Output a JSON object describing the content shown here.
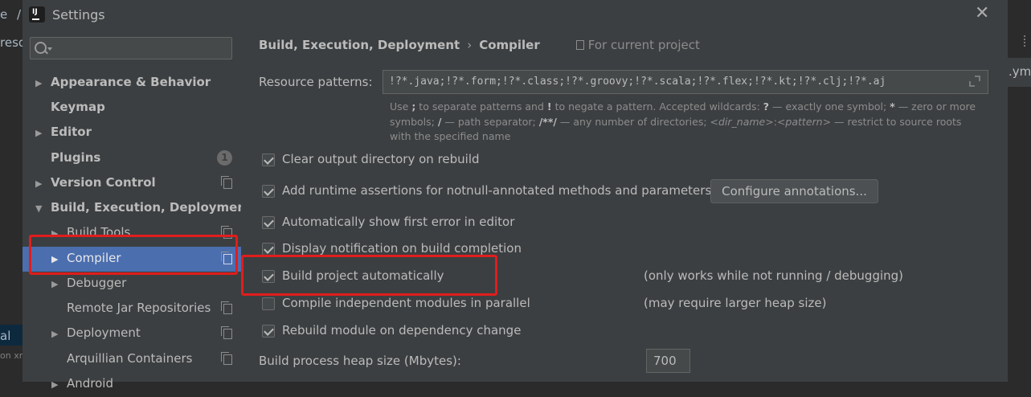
{
  "background": {
    "left_fragments": [
      "e",
      "/",
      "reso",
      "al",
      "on xm"
    ],
    "right_tab": ".yml"
  },
  "window": {
    "title": "Settings",
    "app_icon": "intellij-idea-icon",
    "close_glyph": "✕"
  },
  "sidebar": {
    "search": {
      "value": "",
      "placeholder": ""
    },
    "items": [
      {
        "label": "Appearance & Behavior",
        "arrow": "▶",
        "bold": true
      },
      {
        "label": "Keymap",
        "arrow": "",
        "bold": true
      },
      {
        "label": "Editor",
        "arrow": "▶",
        "bold": true
      },
      {
        "label": "Plugins",
        "arrow": "",
        "bold": true,
        "badge": "1"
      },
      {
        "label": "Version Control",
        "arrow": "▶",
        "bold": true,
        "project_icon": true
      },
      {
        "label": "Build, Execution, Deployment",
        "arrow": "▼",
        "bold": true
      },
      {
        "label": "Build Tools",
        "arrow": "▶",
        "project_icon": true
      },
      {
        "label": "Compiler",
        "arrow": "▶",
        "project_icon": true,
        "selected": true
      },
      {
        "label": "Debugger",
        "arrow": "▶"
      },
      {
        "label": "Remote Jar Repositories",
        "arrow": "",
        "project_icon": true
      },
      {
        "label": "Deployment",
        "arrow": "▶",
        "project_icon": true
      },
      {
        "label": "Arquillian Containers",
        "arrow": "",
        "project_icon": true
      },
      {
        "label": "Android",
        "arrow": "▶"
      }
    ]
  },
  "breadcrumb": {
    "parent": "Build, Execution, Deployment",
    "separator": "›",
    "current": "Compiler",
    "scope": "For current project"
  },
  "resource_patterns": {
    "label": "Resource patterns:",
    "value": "!?*.java;!?*.form;!?*.class;!?*.groovy;!?*.scala;!?*.flex;!?*.kt;!?*.clj;!?*.aj",
    "hint": {
      "t1": "Use ",
      "b1": ";",
      "t2": " to separate patterns and ",
      "b2": "!",
      "t3": " to negate a pattern. Accepted wildcards: ",
      "b3": "?",
      "t4": " — exactly one symbol; ",
      "b4": "*",
      "t5": " — zero or more symbols; ",
      "b5": "/",
      "t6": " — path separator; ",
      "b6": "/**/",
      "t7": " — any number of directories; ",
      "i1": "<dir_name>",
      "t8": ":",
      "i2": "<pattern>",
      "t9": " — restrict to source roots with the specified name"
    }
  },
  "options": [
    {
      "label": "Clear output directory on rebuild",
      "checked": true
    },
    {
      "label": "Add runtime assertions for notnull-annotated methods and parameters",
      "checked": true
    },
    {
      "label": "Automatically show first error in editor",
      "checked": true
    },
    {
      "label": "Display notification on build completion",
      "checked": true
    },
    {
      "label": "Build project automatically",
      "checked": true,
      "note": "(only works while not running / debugging)"
    },
    {
      "label": "Compile independent modules in parallel",
      "checked": false,
      "note": "(may require larger heap size)"
    },
    {
      "label": "Rebuild module on dependency change",
      "checked": true
    }
  ],
  "configure_button": "Configure annotations...",
  "heap": {
    "label": "Build process heap size (Mbytes):",
    "value": "700"
  },
  "colors": {
    "selection": "#4b6eaf",
    "highlight_box": "#e01d1d",
    "dialog_bg": "#3c3f41"
  }
}
